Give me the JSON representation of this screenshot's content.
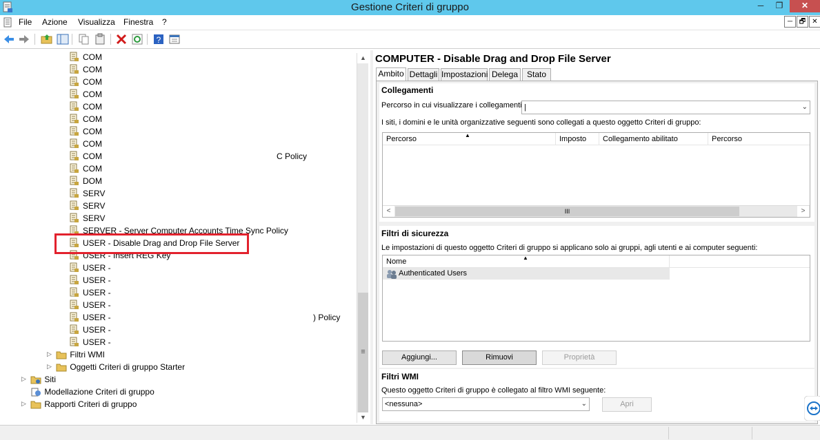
{
  "window": {
    "title": "Gestione Criteri di gruppo",
    "min": "─",
    "max": "❐",
    "close": "✕"
  },
  "menu": {
    "items": [
      "File",
      "Azione",
      "Visualizza",
      "Finestra",
      "?"
    ],
    "mdi": [
      "─",
      "🗗",
      "✕"
    ]
  },
  "toolbar": {
    "icons": [
      "back-arrow-icon",
      "forward-arrow-icon",
      "up-folder-icon",
      "show-hide-tree-icon",
      "copy-icon",
      "paste-icon",
      "delete-icon",
      "refresh-icon",
      "help-icon",
      "properties-icon"
    ]
  },
  "tree": {
    "items": [
      {
        "label": "COM"
      },
      {
        "label": "COM"
      },
      {
        "label": "COM"
      },
      {
        "label": "COM"
      },
      {
        "label": "COM"
      },
      {
        "label": "COM"
      },
      {
        "label": "COM"
      },
      {
        "label": "COM"
      },
      {
        "label": "COM"
      },
      {
        "label": "COM"
      },
      {
        "label": "DOM"
      },
      {
        "label": "SERV"
      },
      {
        "label": "SERV"
      },
      {
        "label": "SERV"
      },
      {
        "label": "SERVER - Server Computer Accounts Time Sync Policy"
      },
      {
        "label": "USER - Disable Drag and Drop File Server"
      },
      {
        "label": "USER - Insert REG Key"
      },
      {
        "label": "USER -"
      },
      {
        "label": "USER -"
      },
      {
        "label": "USER -"
      },
      {
        "label": "USER -"
      },
      {
        "label": "USER -"
      },
      {
        "label": "USER -"
      },
      {
        "label": "USER -"
      }
    ],
    "fragments": {
      "c_policy": "C Policy",
      "paren_policy": ") Policy"
    },
    "folders": [
      {
        "label": "Filtri WMI",
        "expander": "▷"
      },
      {
        "label": "Oggetti Criteri di gruppo Starter",
        "expander": "▷"
      }
    ],
    "roots": [
      {
        "label": "Siti",
        "expander": "▷"
      },
      {
        "label": "Modellazione Criteri di gruppo",
        "expander": ""
      },
      {
        "label": "Rapporti Criteri di gruppo",
        "expander": "▷"
      }
    ],
    "scroll": {
      "up": "▲",
      "down": "▼",
      "grip": "≡"
    }
  },
  "details": {
    "title": "COMPUTER - Disable Drag and Drop File Server",
    "tabs": [
      "Ambito",
      "Dettagli",
      "Impostazioni",
      "Delega",
      "Stato"
    ],
    "links": {
      "heading": "Collegamenti",
      "path_label": "Percorso in cui visualizzare i collegamenti:",
      "path_value": "|",
      "chevron": "⌄",
      "info": "I siti, i domini e le unità organizzative seguenti sono collegati a questo oggetto Criteri di gruppo:",
      "columns": [
        "Percorso",
        "Imposto",
        "Collegamento abilitato",
        "Percorso"
      ],
      "sort_arrow": "▲",
      "hscroll": {
        "left": "<",
        "right": ">",
        "grip": "III"
      }
    },
    "security": {
      "heading": "Filtri di sicurezza",
      "info": "Le impostazioni di questo oggetto Criteri di gruppo si applicano solo ai gruppi, agli utenti e ai computer seguenti:",
      "column": "Nome",
      "sort_arrow": "▲",
      "rows": [
        "Authenticated Users"
      ],
      "buttons": {
        "add": "Aggiungi...",
        "remove": "Rimuovi",
        "properties": "Proprietà"
      }
    },
    "wmi": {
      "heading": "Filtri WMI",
      "info": "Questo oggetto Criteri di gruppo è collegato al filtro WMI seguente:",
      "value": "<nessuna>",
      "chevron": "⌄",
      "open": "Apri"
    }
  }
}
